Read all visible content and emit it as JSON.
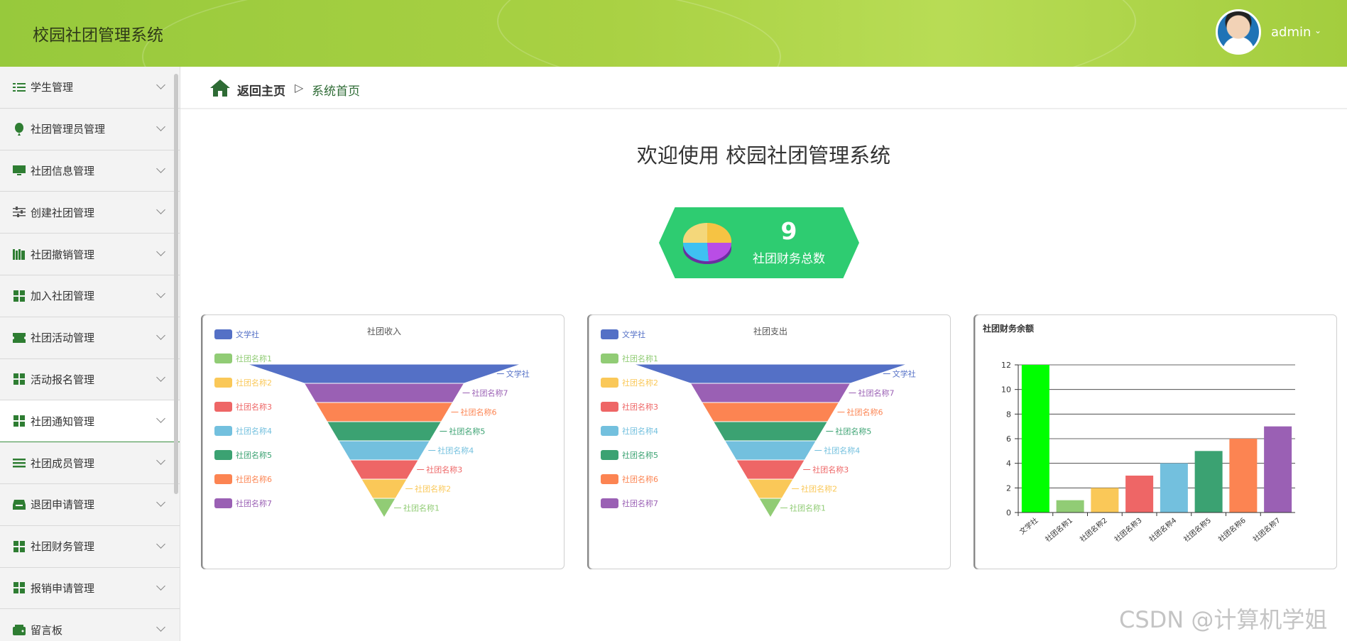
{
  "app": {
    "title": "校园社团管理系统"
  },
  "user": {
    "name": "admin"
  },
  "sidebar": {
    "items": [
      {
        "label": "学生管理",
        "icon": "list-icon"
      },
      {
        "label": "社团管理员管理",
        "icon": "balloon-icon"
      },
      {
        "label": "社团信息管理",
        "icon": "monitor-icon"
      },
      {
        "label": "创建社团管理",
        "icon": "sliders-icon"
      },
      {
        "label": "社团撤销管理",
        "icon": "books-icon"
      },
      {
        "label": "加入社团管理",
        "icon": "grid-icon"
      },
      {
        "label": "社团活动管理",
        "icon": "ticket-icon"
      },
      {
        "label": "活动报名管理",
        "icon": "grid-icon"
      },
      {
        "label": "社团通知管理",
        "icon": "grid-icon"
      },
      {
        "label": "社团成员管理",
        "icon": "bars-icon"
      },
      {
        "label": "退团申请管理",
        "icon": "inbox-icon"
      },
      {
        "label": "社团财务管理",
        "icon": "grid-icon"
      },
      {
        "label": "报销申请管理",
        "icon": "grid-icon"
      },
      {
        "label": "留言板",
        "icon": "wallet-icon"
      }
    ],
    "active_index": 8
  },
  "breadcrumb": {
    "home": "返回主页",
    "separator": "▷",
    "current": "系统首页"
  },
  "welcome": "欢迎使用 校园社团管理系统",
  "stat": {
    "value": "9",
    "label": "社团财务总数",
    "icon": "pie-chart-icon"
  },
  "colors": {
    "header": "#a5cf40",
    "accent_green": "#2ecc71",
    "dark_green": "#2e6b35",
    "series": [
      "#5470c6",
      "#91cc75",
      "#fac858",
      "#ee6666",
      "#73c0de",
      "#3ba272",
      "#fc8452",
      "#9a60b4"
    ]
  },
  "watermark": "CSDN @计算机学姐",
  "chart_data": [
    {
      "type": "funnel",
      "title": "社团收入",
      "legend_position": "left",
      "categories": [
        "文学社",
        "社团名称1",
        "社团名称2",
        "社团名称3",
        "社团名称4",
        "社团名称5",
        "社团名称6",
        "社团名称7"
      ],
      "values": [
        12,
        1,
        2,
        3,
        4,
        5,
        6,
        7
      ]
    },
    {
      "type": "funnel",
      "title": "社团支出",
      "legend_position": "left",
      "categories": [
        "文学社",
        "社团名称1",
        "社团名称2",
        "社团名称3",
        "社团名称4",
        "社团名称5",
        "社团名称6",
        "社团名称7"
      ],
      "values": [
        12,
        1,
        2,
        3,
        4,
        5,
        6,
        7
      ]
    },
    {
      "type": "bar",
      "title": "社团财务余额",
      "categories": [
        "文学社",
        "社团名称1",
        "社团名称2",
        "社团名称3",
        "社团名称4",
        "社团名称5",
        "社团名称6",
        "社团名称7"
      ],
      "values": [
        12,
        1,
        2,
        3,
        4,
        5,
        6,
        7
      ],
      "bar_colors": [
        "#00ff00",
        "#91cc75",
        "#fac858",
        "#ee6666",
        "#73c0de",
        "#3ba272",
        "#fc8452",
        "#9a60b4"
      ],
      "ylim": [
        0,
        12
      ],
      "yticks": [
        0,
        2,
        4,
        6,
        8,
        10,
        12
      ],
      "grid": true
    }
  ]
}
